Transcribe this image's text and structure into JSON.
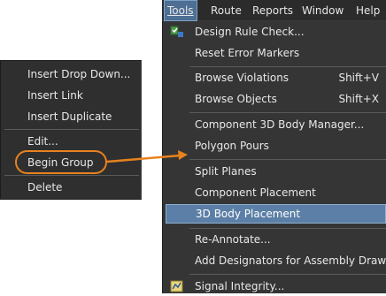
{
  "context_menu": {
    "items": [
      {
        "label": "Insert Drop Down..."
      },
      {
        "label": "Insert Link"
      },
      {
        "label": "Insert Duplicate"
      },
      {
        "label": "Edit..."
      },
      {
        "label": "Begin Group"
      },
      {
        "label": "Delete"
      }
    ]
  },
  "menubar": {
    "tools": "Tools",
    "route": "Route",
    "reports": "Reports",
    "window": "Window",
    "help": "Help"
  },
  "tools_menu": {
    "items": [
      {
        "label": "Design Rule Check...",
        "icon": "drc-icon"
      },
      {
        "label": "Reset Error Markers"
      },
      {
        "label": "Browse Violations",
        "shortcut": "Shift+V"
      },
      {
        "label": "Browse Objects",
        "shortcut": "Shift+X"
      },
      {
        "label": "Component 3D Body Manager..."
      },
      {
        "label": "Polygon Pours"
      },
      {
        "label": "Split Planes"
      },
      {
        "label": "Component Placement"
      },
      {
        "label": "3D Body Placement"
      },
      {
        "label": "Re-Annotate..."
      },
      {
        "label": "Add Designators for Assembly Drawing"
      },
      {
        "label": "Signal Integrity...",
        "icon": "signal-integrity-icon"
      }
    ]
  },
  "colors": {
    "callout": "#e8821e",
    "highlight": "#5b7fa6",
    "menu_bg": "#353535"
  }
}
